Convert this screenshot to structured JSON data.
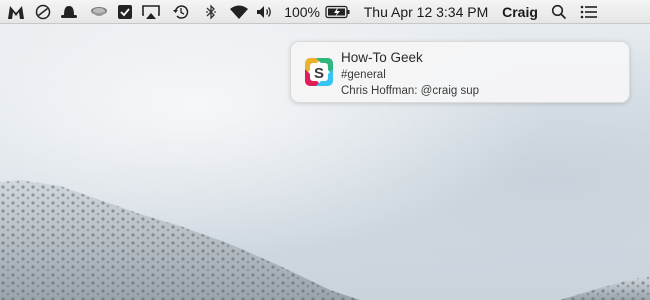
{
  "menubar": {
    "icons": [
      "malwarebytes-icon",
      "do-not-disturb-icon",
      "alfred-hat-icon",
      "tea-cup-icon",
      "checkmark-app-icon",
      "airplay-icon",
      "time-machine-icon",
      "bluetooth-icon",
      "wifi-icon",
      "volume-icon"
    ],
    "battery_percent": "100%",
    "datetime": "Thu Apr 12  3:34 PM",
    "user": "Craig"
  },
  "notification": {
    "app_icon": "slack-icon",
    "title": "How-To Geek",
    "channel": "#general",
    "message": "Chris Hoffman: @craig sup"
  },
  "colors": {
    "menubar_bg": "#ececec",
    "notification_bg": "#f5f5f6",
    "slack_yellow": "#ecb22e",
    "slack_green": "#2eb67d",
    "slack_red": "#e01e5a",
    "slack_blue": "#36c5f0"
  }
}
